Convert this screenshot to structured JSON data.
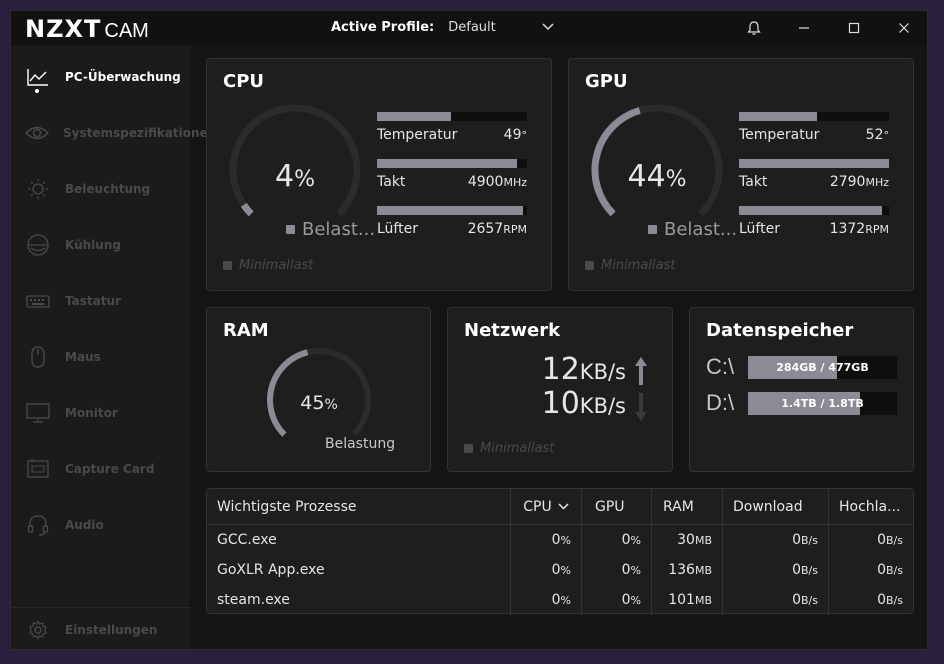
{
  "app": {
    "logo_brand": "NZXT",
    "logo_product": "CAM"
  },
  "titlebar": {
    "profile_label": "Active Profile:",
    "profile_value": "Default"
  },
  "sidebar": {
    "items": [
      {
        "label": "PC-Überwachung",
        "icon": "monitoring-chart-icon",
        "active": true
      },
      {
        "label": "Systemspezifikationen",
        "icon": "eye-icon"
      },
      {
        "label": "Beleuchtung",
        "icon": "sun-icon"
      },
      {
        "label": "Kühlung",
        "icon": "fan-icon"
      },
      {
        "label": "Tastatur",
        "icon": "keyboard-icon"
      },
      {
        "label": "Maus",
        "icon": "mouse-icon"
      },
      {
        "label": "Monitor",
        "icon": "monitor-icon"
      },
      {
        "label": "Capture Card",
        "icon": "capture-card-icon"
      },
      {
        "label": "Audio",
        "icon": "headset-icon"
      }
    ],
    "settings_label": "Einstellungen"
  },
  "cpu": {
    "title": "CPU",
    "load_value": "4",
    "load_unit": "%",
    "load_fraction": 0.04,
    "load_label": "Belast...",
    "minimal_label": "Minimallast",
    "stats": [
      {
        "label": "Temperatur",
        "value": "49",
        "unit": "°",
        "fill": 0.49
      },
      {
        "label": "Takt",
        "value": "4900",
        "unit": "MHz",
        "fill": 0.93
      },
      {
        "label": "Lüfter",
        "value": "2657",
        "unit": "RPM",
        "fill": 0.97
      }
    ]
  },
  "gpu": {
    "title": "GPU",
    "load_value": "44",
    "load_unit": "%",
    "load_fraction": 0.44,
    "load_label": "Belast...",
    "minimal_label": "Minimallast",
    "stats": [
      {
        "label": "Temperatur",
        "value": "52",
        "unit": "°",
        "fill": 0.52
      },
      {
        "label": "Takt",
        "value": "2790",
        "unit": "MHz",
        "fill": 1.0
      },
      {
        "label": "Lüfter",
        "value": "1372",
        "unit": "RPM",
        "fill": 0.95
      }
    ]
  },
  "ram": {
    "title": "RAM",
    "load_value": "45",
    "load_unit": "%",
    "load_fraction": 0.45,
    "load_label": "Belastung"
  },
  "network": {
    "title": "Netzwerk",
    "up_value": "12",
    "up_unit": "KB/s",
    "down_value": "10",
    "down_unit": "KB/s",
    "minimal_label": "Minimallast"
  },
  "storage": {
    "title": "Datenspeicher",
    "drives": [
      {
        "letter": "C:\\",
        "text": "284GB / 477GB",
        "fill": 0.595
      },
      {
        "letter": "D:\\",
        "text": "1.4TB / 1.8TB",
        "fill": 0.75
      }
    ]
  },
  "processes": {
    "headers": [
      "Wichtigste Prozesse",
      "CPU",
      "GPU",
      "RAM",
      "Download",
      "Hochla..."
    ],
    "rows": [
      {
        "name": "GCC.exe",
        "cpu": "0",
        "gpu": "0",
        "ram": "30",
        "ram_unit": "MB",
        "download": "0",
        "upload": "0"
      },
      {
        "name": "GoXLR App.exe",
        "cpu": "0",
        "gpu": "0",
        "ram": "136",
        "ram_unit": "MB",
        "download": "0",
        "upload": "0"
      },
      {
        "name": "steam.exe",
        "cpu": "0",
        "gpu": "0",
        "ram": "101",
        "ram_unit": "MB",
        "download": "0",
        "upload": "0"
      }
    ],
    "percent_unit": "%",
    "rate_unit": "B/s"
  },
  "colors": {
    "accent": "#8d8a96",
    "track": "#2b2b2b",
    "card": "#1e1e1e"
  }
}
